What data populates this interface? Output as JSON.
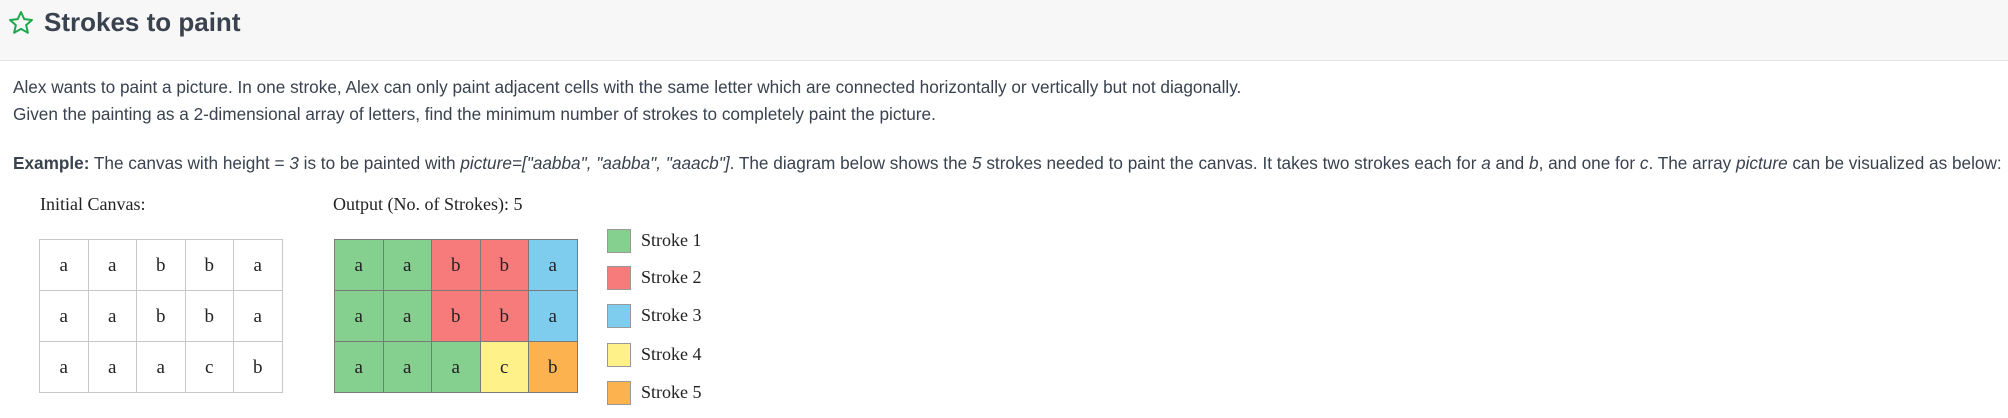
{
  "header": {
    "title": "Strokes to paint",
    "star_icon": "star-outline-icon",
    "accent_color": "#1ba94c"
  },
  "description": {
    "line1": "Alex wants to paint a picture. In one stroke, Alex can only paint adjacent cells with the same letter which are connected horizontally or vertically but not diagonally.",
    "line2": "Given the painting as a 2-dimensional array of letters, find the minimum number of strokes to completely paint the picture.",
    "example": {
      "label": "Example:",
      "t1": " The canvas with height = ",
      "height": "3",
      "t2": " is to be painted with ",
      "picture_text": "picture=[\"aabba\", \"aabba\", \"aaacb\"]",
      "t3": ". The diagram below shows the ",
      "strokes_count": "5",
      "t4": " strokes needed to paint the canvas. It takes two strokes each for ",
      "a": "a",
      "t5": " and ",
      "b": "b",
      "t6": ", and one for ",
      "c": "c",
      "t7": ". The array ",
      "picture_word": "picture",
      "t8": " can be visualized as below:"
    }
  },
  "figure": {
    "initial_label": "Initial Canvas:",
    "output_label": "Output (No. of Strokes): 5",
    "initial_grid": [
      [
        "a",
        "a",
        "b",
        "b",
        "a"
      ],
      [
        "a",
        "a",
        "b",
        "b",
        "a"
      ],
      [
        "a",
        "a",
        "a",
        "c",
        "b"
      ]
    ],
    "output_grid": [
      [
        "a",
        "a",
        "b",
        "b",
        "a"
      ],
      [
        "a",
        "a",
        "b",
        "b",
        "a"
      ],
      [
        "a",
        "a",
        "a",
        "c",
        "b"
      ]
    ],
    "output_strokes": [
      [
        1,
        1,
        2,
        2,
        3
      ],
      [
        1,
        1,
        2,
        2,
        3
      ],
      [
        1,
        1,
        1,
        4,
        5
      ]
    ],
    "legend": [
      {
        "label": "Stroke 1",
        "color": "#85cf8f"
      },
      {
        "label": "Stroke 2",
        "color": "#f77b7b"
      },
      {
        "label": "Stroke 3",
        "color": "#7fcdee"
      },
      {
        "label": "Stroke 4",
        "color": "#fff18a"
      },
      {
        "label": "Stroke 5",
        "color": "#fbb24f"
      }
    ]
  }
}
